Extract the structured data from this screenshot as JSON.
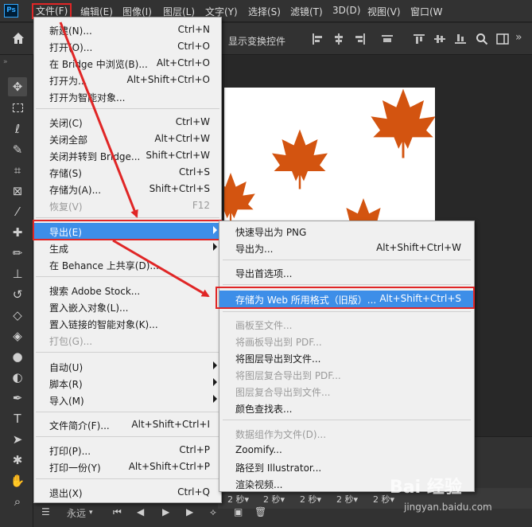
{
  "app": {
    "logo": "Ps",
    "accent": "#31a8ff",
    "highlight_color": "#e02626",
    "selection_color": "#3d8ee8"
  },
  "menubar": [
    {
      "key": "file",
      "label": "文件(F)"
    },
    {
      "key": "edit",
      "label": "编辑(E)"
    },
    {
      "key": "image",
      "label": "图像(I)"
    },
    {
      "key": "layer",
      "label": "图层(L)"
    },
    {
      "key": "type",
      "label": "文字(Y)"
    },
    {
      "key": "select",
      "label": "选择(S)"
    },
    {
      "key": "filter",
      "label": "滤镜(T)"
    },
    {
      "key": "3d",
      "label": "3D(D)"
    },
    {
      "key": "view",
      "label": "视图(V)"
    },
    {
      "key": "window",
      "label": "窗口(W"
    }
  ],
  "options_bar": {
    "label": "显示变换控件",
    "icons": [
      "home-icon",
      "align-icon",
      "search-icon",
      "workspace-icon",
      "more-icon"
    ]
  },
  "file_menu": {
    "items": [
      {
        "label": "新建(N)...",
        "shortcut": "Ctrl+N"
      },
      {
        "label": "打开(O)...",
        "shortcut": "Ctrl+O"
      },
      {
        "label": "在 Bridge 中浏览(B)...",
        "shortcut": "Alt+Ctrl+O"
      },
      {
        "label": "打开为...",
        "shortcut": "Alt+Shift+Ctrl+O"
      },
      {
        "label": "打开为智能对象..."
      },
      {
        "label": "关闭(C)",
        "shortcut": "Ctrl+W"
      },
      {
        "label": "关闭全部",
        "shortcut": "Alt+Ctrl+W"
      },
      {
        "label": "关闭并转到 Bridge...",
        "shortcut": "Shift+Ctrl+W"
      },
      {
        "label": "存储(S)",
        "shortcut": "Ctrl+S"
      },
      {
        "label": "存储为(A)...",
        "shortcut": "Shift+Ctrl+S"
      },
      {
        "label": "恢复(V)",
        "shortcut": "F12",
        "disabled": true
      },
      {
        "label": "导出(E)",
        "highlighted": true,
        "submenu": true
      },
      {
        "label": "生成",
        "submenu": true
      },
      {
        "label": "在 Behance 上共享(D)..."
      },
      {
        "label": "搜索 Adobe Stock..."
      },
      {
        "label": "置入嵌入对象(L)..."
      },
      {
        "label": "置入链接的智能对象(K)..."
      },
      {
        "label": "打包(G)...",
        "disabled": true
      },
      {
        "label": "自动(U)",
        "submenu": true
      },
      {
        "label": "脚本(R)",
        "submenu": true
      },
      {
        "label": "导入(M)",
        "submenu": true
      },
      {
        "label": "文件简介(F)...",
        "shortcut": "Alt+Shift+Ctrl+I"
      },
      {
        "label": "打印(P)...",
        "shortcut": "Ctrl+P"
      },
      {
        "label": "打印一份(Y)",
        "shortcut": "Alt+Shift+Ctrl+P"
      },
      {
        "label": "退出(X)",
        "shortcut": "Ctrl+Q"
      }
    ]
  },
  "export_submenu": {
    "items": [
      {
        "label": "快速导出为 PNG"
      },
      {
        "label": "导出为...",
        "shortcut": "Alt+Shift+Ctrl+W"
      },
      {
        "label": "导出首选项..."
      },
      {
        "label": "存储为 Web 所用格式（旧版）...",
        "shortcut": "Alt+Shift+Ctrl+S",
        "highlighted": true
      },
      {
        "label": "画板至文件...",
        "disabled": true
      },
      {
        "label": "将画板导出到 PDF...",
        "disabled": true
      },
      {
        "label": "将图层导出到文件..."
      },
      {
        "label": "将图层复合导出到 PDF...",
        "disabled": true
      },
      {
        "label": "图层复合导出到文件...",
        "disabled": true
      },
      {
        "label": "颜色查找表..."
      },
      {
        "label": "数据组作为文件(D)...",
        "disabled": true
      },
      {
        "label": "Zoomify..."
      },
      {
        "label": "路径到 Illustrator..."
      },
      {
        "label": "渲染视频..."
      }
    ]
  },
  "timeline": {
    "loop_label": "永远",
    "frame_delay": "2 秒",
    "frame_delay_arrow": "▾"
  },
  "canvas": {
    "leaf_color": "#d35410",
    "background": "#ffffff"
  },
  "watermark": {
    "logo": "Bai 经验",
    "url": "jingyan.baidu.com"
  }
}
